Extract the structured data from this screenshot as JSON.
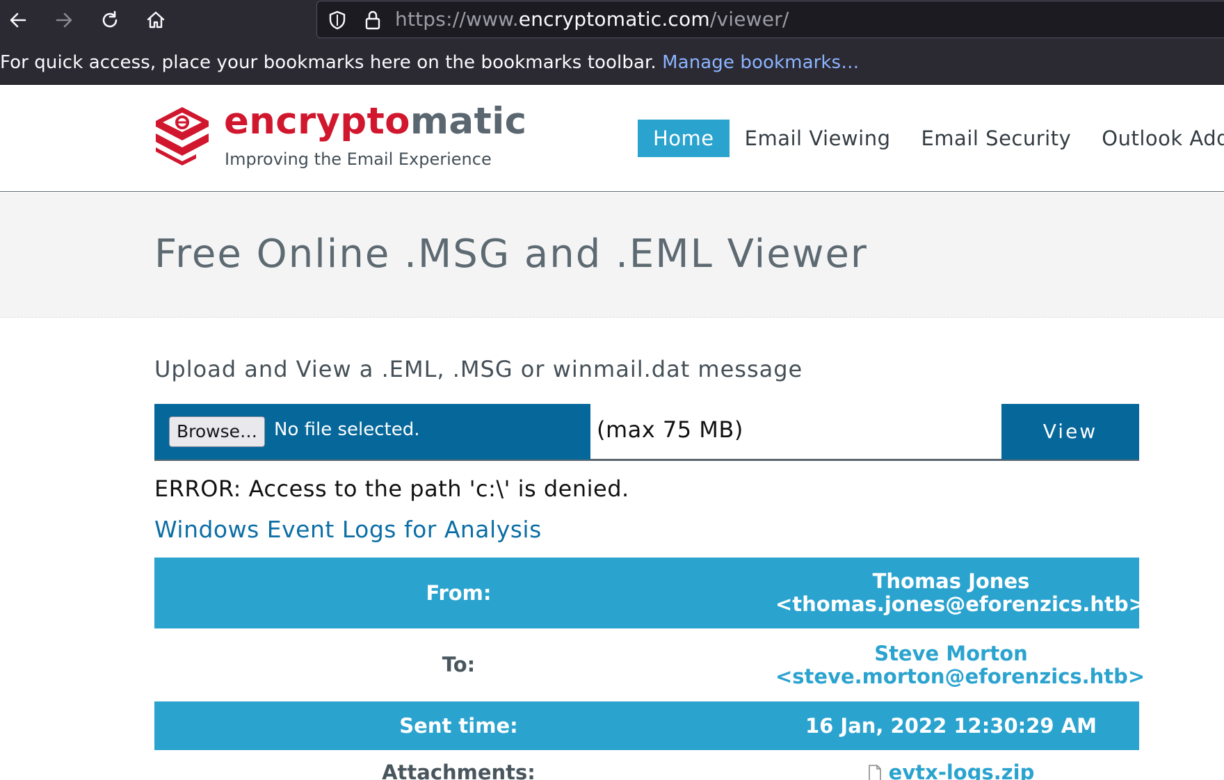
{
  "browser": {
    "url_prefix": "https://www.",
    "url_host": "encryptomatic.com",
    "url_path": "/viewer/",
    "bookmarks_message": "For quick access, place your bookmarks here on the bookmarks toolbar.",
    "manage_bookmarks_label": "Manage bookmarks…",
    "icons": [
      "back-arrow-icon",
      "forward-arrow-icon",
      "reload-icon",
      "home-icon",
      "shield-icon",
      "lock-icon"
    ]
  },
  "site": {
    "logo_red": "encrypto",
    "logo_gray": "matic",
    "tagline": "Improving the Email Experience",
    "nav": [
      {
        "label": "Home",
        "active": true
      },
      {
        "label": "Email Viewing",
        "active": false
      },
      {
        "label": "Email Security",
        "active": false
      },
      {
        "label": "Outlook Add",
        "active": false
      }
    ],
    "colors": {
      "brand_red": "#d0172e",
      "nav_active": "#2ba3cf",
      "upload_bar": "#06679b"
    }
  },
  "banner": {
    "title": "Free Online .MSG and .EML Viewer"
  },
  "upload": {
    "heading": "Upload and View a .EML, .MSG or winmail.dat message",
    "browse_label": "Browse…",
    "file_status": "No file selected.",
    "max_size": "(max 75 MB)",
    "view_label": "View"
  },
  "result": {
    "error": "ERROR: Access to the path 'c:\\' is denied.",
    "subject": "Windows Event Logs for Analysis",
    "from_label": "From:",
    "from_name": "Thomas Jones",
    "from_email": "<thomas.jones@eforenzics.htb>",
    "to_label": "To:",
    "to_name": "Steve Morton",
    "to_email": "<steve.morton@eforenzics.htb>",
    "sent_label": "Sent time:",
    "sent_value": "16 Jan, 2022 12:30:29 AM",
    "attachments_label": "Attachments:",
    "attachment_file": "evtx-logs.zip"
  }
}
